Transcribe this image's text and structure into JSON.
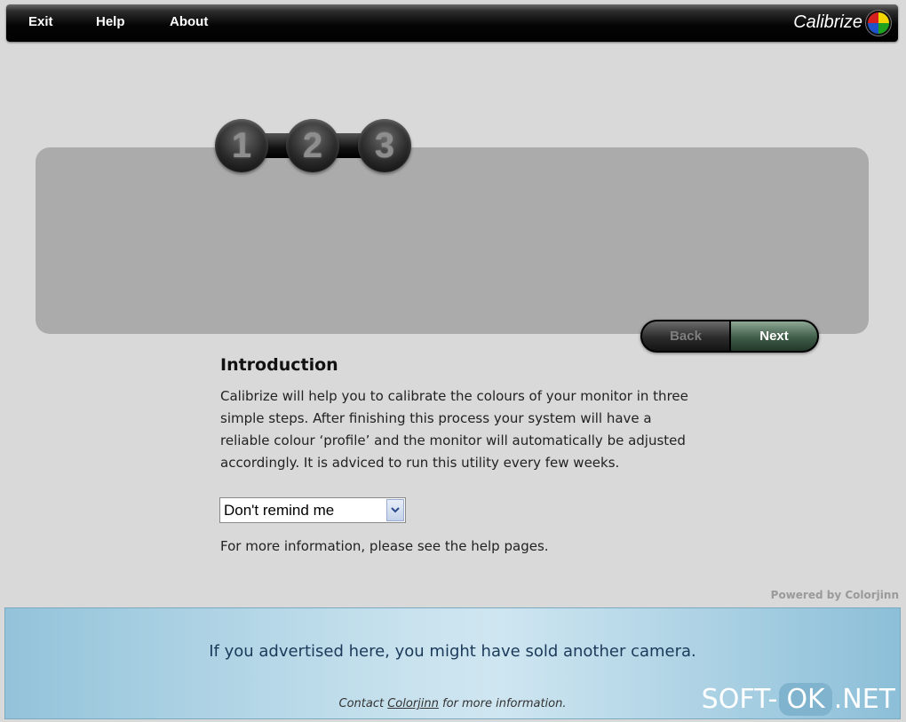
{
  "menu": {
    "exit": "Exit",
    "help": "Help",
    "about": "About"
  },
  "brand": {
    "name": "Calibrize"
  },
  "steps": [
    "1",
    "2",
    "3"
  ],
  "nav": {
    "back": "Back",
    "next": "Next"
  },
  "intro": {
    "title": "Introduction",
    "body": "Calibrize will help you to calibrate the colours of your monitor in three simple steps. After finishing this process your system will have a reliable colour ‘profile’ and the monitor will automatically be adjusted accordingly. It is adviced to run this utility every few weeks.",
    "reminder_select": "Don't remind me",
    "more_info": "For more information, please see the help pages."
  },
  "powered_by": "Powered by Colorjinn",
  "ad": {
    "text": "If you advertised here, you might have sold another camera.",
    "contact_prefix": "Contact ",
    "contact_link": "Colorjinn",
    "contact_suffix": " for more information."
  },
  "watermark": {
    "left": "SOFT-",
    "middle": "OK",
    "right": ".NET"
  },
  "colors": {
    "background": "#d9d9d9",
    "panel": "#ababab",
    "next_button": "#3f5d48",
    "ad_bar": "#c8e2ee"
  }
}
